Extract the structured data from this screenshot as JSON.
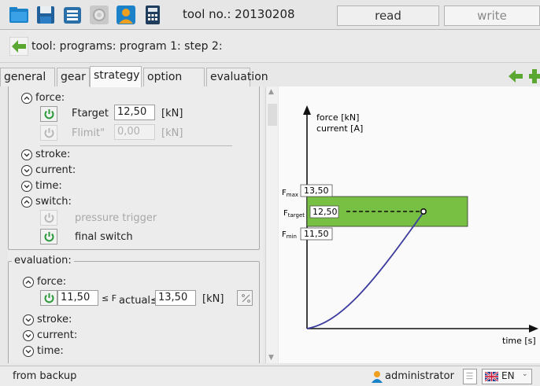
{
  "toolbar": {
    "icons": [
      "folder-open-icon",
      "save-icon",
      "print-icon",
      "settings-gear-icon",
      "user-admin-icon",
      "calculator-icon"
    ],
    "tool_label": "tool no.: 20130208",
    "read_label": "read",
    "write_label": "write"
  },
  "breadcrumb": {
    "back_icon": "back-arrow-icon",
    "text": "tool: programs: program 1: step 2:"
  },
  "tabs": [
    {
      "label": "general",
      "active": false
    },
    {
      "label": "gear",
      "active": false
    },
    {
      "label": "strategy",
      "active": true
    },
    {
      "label": "option",
      "active": false
    },
    {
      "label": "evaluation",
      "active": false
    }
  ],
  "strategy": {
    "force": {
      "label": "force:",
      "ftarget_label": "Ftarget",
      "ftarget_value": "12,50",
      "ftarget_unit": "[kN]",
      "flimit_label": "Flimit\"",
      "flimit_value": "0,00",
      "flimit_unit": "[kN]"
    },
    "stroke_label": "stroke:",
    "current_label": "current:",
    "time_label": "time:",
    "switch": {
      "label": "switch:",
      "pressure_trigger": "pressure trigger",
      "final_switch": "final switch"
    }
  },
  "evaluation": {
    "legend": "evaluation:",
    "force_label": "force:",
    "min_value": "11,50",
    "le_f": "≤ F",
    "actual_le": "actual≤",
    "max_value": "13,50",
    "unit": "[kN]",
    "stroke_label": "stroke:",
    "current_label": "current:",
    "time_label": "time:"
  },
  "chart_data": {
    "type": "line",
    "ylabel_line1": "force [kN]",
    "ylabel_line2": "current [A]",
    "xlabel": "time [s]",
    "fmax_label": "F",
    "fmax_sub": "max",
    "fmax_value": "13,50",
    "ftarget_label": "F",
    "ftarget_sub": "target",
    "ftarget_value": "12,50",
    "fmin_label": "F",
    "fmin_sub": "min",
    "fmin_value": "11,50",
    "band": [
      11.5,
      13.5
    ],
    "target": 12.5,
    "curve_color": "#3b3b9e",
    "band_color": "#78c044"
  },
  "statusbar": {
    "text": "from backup",
    "user": "administrator",
    "language": "EN"
  }
}
